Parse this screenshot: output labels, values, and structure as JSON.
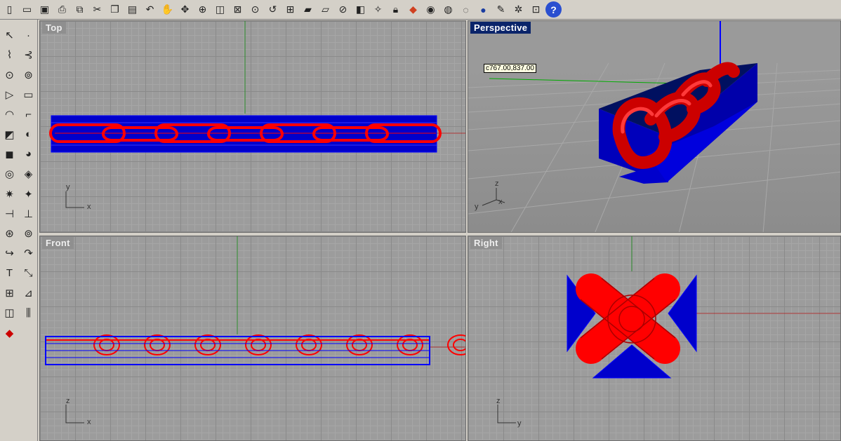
{
  "toolbar": {
    "icons": [
      "new-file-icon",
      "open-folder-icon",
      "save-icon",
      "print-icon",
      "import-icon",
      "cut-icon",
      "copy-icon",
      "paste-icon",
      "undo-icon",
      "pan-hand-icon",
      "rotate-view-icon",
      "zoom-dynamic-icon",
      "zoom-window-icon",
      "zoom-extents-icon",
      "zoom-selected-icon",
      "undo-view-icon",
      "four-viewports-icon",
      "named-views-icon",
      "construction-plane-icon",
      "grid-snap-icon",
      "osnap-icon",
      "light-bulb-icon",
      "lock-icon",
      "layer-icon",
      "color-wheel-icon",
      "wireframe-sphere-icon",
      "shaded-sphere-icon",
      "rendered-sphere-icon",
      "render-icon",
      "options-gear-icon",
      "group-icon",
      "help-icon"
    ]
  },
  "viewports": {
    "top": {
      "title": "Top"
    },
    "perspective": {
      "title": "Perspective"
    },
    "front": {
      "title": "Front"
    },
    "right": {
      "title": "Right"
    }
  },
  "axes": {
    "top": {
      "v": "y",
      "h": "x"
    },
    "perspective": {
      "v": "z",
      "h": "x",
      "side": "y"
    },
    "front": {
      "v": "z",
      "h": "x"
    },
    "right": {
      "v": "z",
      "h": "y"
    }
  },
  "tooltip": {
    "text": "c767.00,837.00"
  },
  "colors": {
    "chain": "#ff0000",
    "box": "#0000cc",
    "active_title": "#0a246a",
    "x_axis": "#aa0000",
    "y_axis": "#00aa00",
    "z_axis": "#0000cc"
  }
}
